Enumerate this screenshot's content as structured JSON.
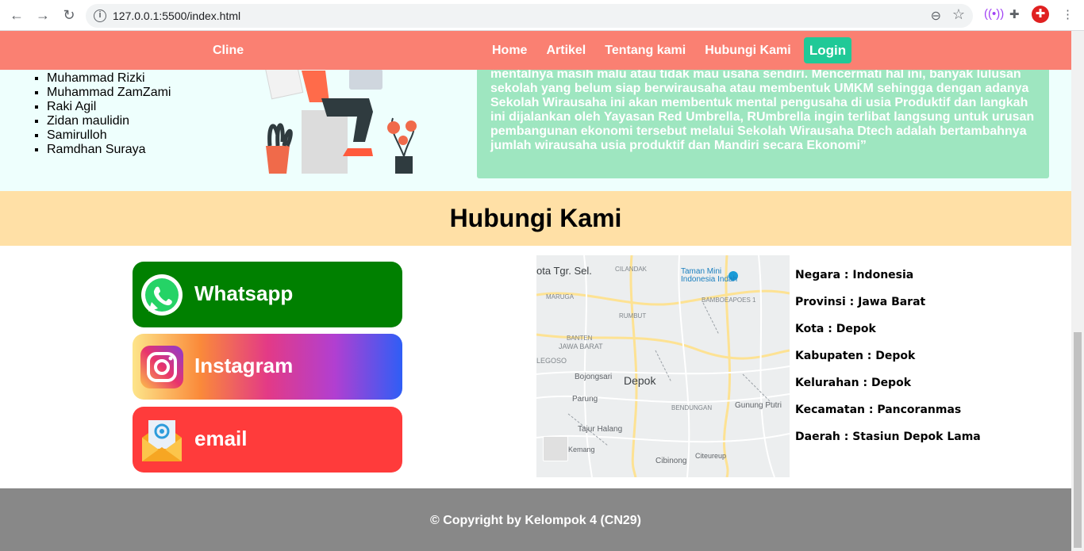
{
  "browser": {
    "url": "127.0.0.1:5500/index.html"
  },
  "navbar": {
    "brand": "Cline",
    "items": [
      "Home",
      "Artikel",
      "Tentang kami",
      "Hubungi Kami"
    ],
    "login": "Login"
  },
  "about": {
    "members": [
      "Muhammad Rizki",
      "Muhammad ZamZami",
      "Raki Agil",
      "Zidan maulidin",
      "Samirulloh",
      "Ramdhan Suraya"
    ],
    "quote": "mentalnya masih malu atau tidak mau usaha sendiri. Mencermati hal ini, banyak lulusan sekolah yang belum siap berwirausaha atau membentuk UMKM sehingga dengan adanya Sekolah Wirausaha ini akan membentuk mental pengusaha di usia Produktif dan langkah ini dijalankan oleh Yayasan Red Umbrella, RUmbrella ingin terlibat langsung untuk urusan pembangunan ekonomi tersebut melalui Sekolah Wirausaha Dtech adalah bertambahnya jumlah wirausaha usia produktif dan Mandiri secara Ekonomi”"
  },
  "contact": {
    "title": "Hubungi Kami",
    "buttons": {
      "whatsapp": "Whatsapp",
      "instagram": "Instagram",
      "email": "email"
    },
    "map_labels": {
      "tangerang": "ota Tgr. Sel.",
      "taman_mini": "Taman Mini Indonesia Indah",
      "depok": "Depok",
      "bojongsari": "Bojongsari",
      "parung": "Parung",
      "tajur": "Tajur Halang",
      "kemang": "Kemang",
      "cibinong": "Cibinong",
      "citeureup": "Citeureup",
      "gunung_putri": "Gunung Putri",
      "ciganjur": "CILANDAK",
      "bamboe": "BAMBOEAPOES 1",
      "rumbut": "RUMBUT",
      "banten": "BANTEN",
      "jawa_barat": "JAWA BARAT",
      "maruga": "MARUGA",
      "bendungan": "BENDUNGAN",
      "legoso": "LEGOSO"
    },
    "address": [
      "Negara : Indonesia",
      "Provinsi : Jawa Barat",
      "Kota : Depok",
      "Kabupaten : Depok",
      "Kelurahan : Depok",
      "Kecamatan : Pancoranmas",
      "Daerah : Stasiun Depok Lama"
    ]
  },
  "footer": {
    "copyright": "© Copyright by Kelompok 4 (CN29)"
  }
}
